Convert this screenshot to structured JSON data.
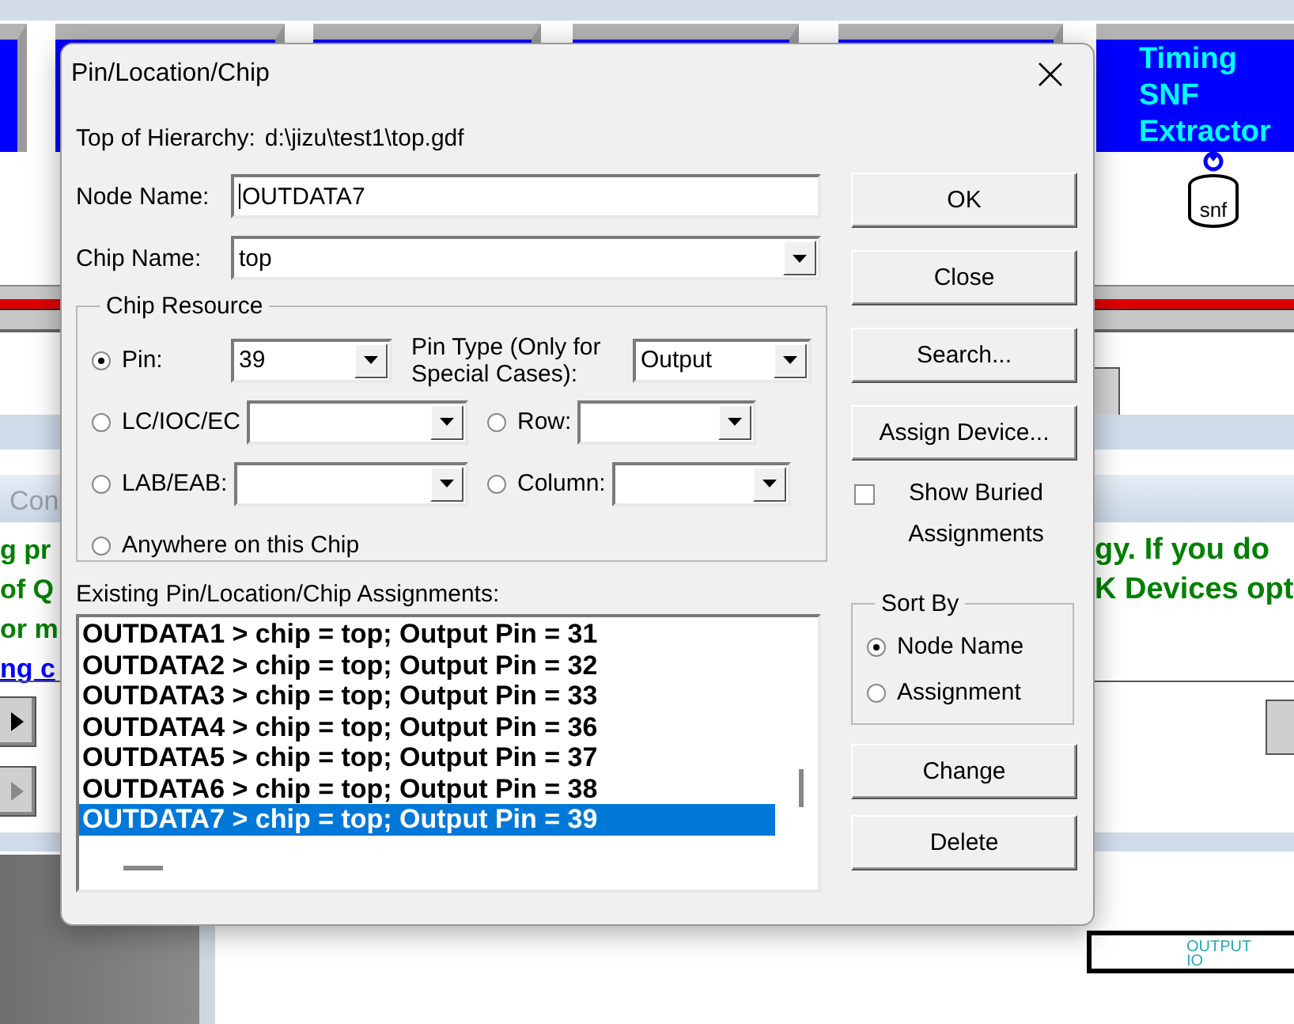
{
  "background": {
    "tool_tile": {
      "lines": [
        "Timing",
        "SNF",
        "Extractor"
      ]
    },
    "tool_icon_label": "snf",
    "panel_title": "Con",
    "left_lines": [
      {
        "text": "g pr",
        "kind": "note"
      },
      {
        "text": "of Q",
        "kind": "note"
      },
      {
        "text": "or m",
        "kind": "note"
      },
      {
        "text": "ng c",
        "kind": "link"
      }
    ],
    "right_lines": [
      "gy. If you do",
      "K Devices opt"
    ],
    "left_buttons": [
      {
        "disabled": false
      },
      {
        "disabled": true
      }
    ],
    "schematic_labels": [
      "OUTPUT",
      "IO"
    ]
  },
  "dialog": {
    "title": "Pin/Location/Chip",
    "hierarchy": {
      "label": "Top of Hierarchy:",
      "value": "d:\\jizu\\test1\\top.gdf"
    },
    "node_name": {
      "label": "Node Name:",
      "value": "OUTDATA7",
      "focused": true
    },
    "chip_name": {
      "label": "Chip Name:",
      "value": "top"
    },
    "chip_resource": {
      "title": "Chip Resource",
      "rows": [
        [
          {
            "kind": "radio",
            "label": "Pin:",
            "selected": true,
            "combo": true,
            "value": "39"
          },
          {
            "kind": "caption",
            "label": "Pin Type (Only for Special Cases):",
            "combo": true,
            "value": "Output"
          }
        ],
        [
          {
            "kind": "radio",
            "label": "LC/IOC/EC",
            "selected": false,
            "combo": true
          },
          {
            "kind": "radio",
            "label": "Row:",
            "selected": false,
            "combo": true
          }
        ],
        [
          {
            "kind": "radio",
            "label": "LAB/EAB:",
            "selected": false,
            "combo": true
          },
          {
            "kind": "radio",
            "label": "Column:",
            "selected": false,
            "combo": true
          }
        ],
        [
          {
            "kind": "radio",
            "label": "Anywhere on this Chip",
            "selected": false,
            "combo": false
          }
        ]
      ]
    },
    "assignments": {
      "label": "Existing Pin/Location/Chip Assignments:",
      "items": [
        {
          "text": "OUTDATA1 > chip = top; Output Pin = 31",
          "selected": false
        },
        {
          "text": "OUTDATA2 > chip = top; Output Pin = 32",
          "selected": false
        },
        {
          "text": "OUTDATA3 > chip = top; Output Pin = 33",
          "selected": false
        },
        {
          "text": "OUTDATA4 > chip = top; Output Pin = 36",
          "selected": false
        },
        {
          "text": "OUTDATA5 > chip = top; Output Pin = 37",
          "selected": false
        },
        {
          "text": "OUTDATA6 > chip = top; Output Pin = 38",
          "selected": false
        },
        {
          "text": "OUTDATA7 > chip = top; Output Pin = 39",
          "selected": true
        }
      ]
    },
    "buttons_top": [
      "OK",
      "Close",
      "Search...",
      "Assign Device..."
    ],
    "show_buried": {
      "label": "Show Buried Assignments",
      "checked": false
    },
    "sort_by": {
      "title": "Sort By",
      "options": [
        {
          "label": "Node Name",
          "selected": true
        },
        {
          "label": "Assignment",
          "selected": false
        }
      ]
    },
    "buttons_bottom": [
      "Change",
      "Delete"
    ]
  }
}
